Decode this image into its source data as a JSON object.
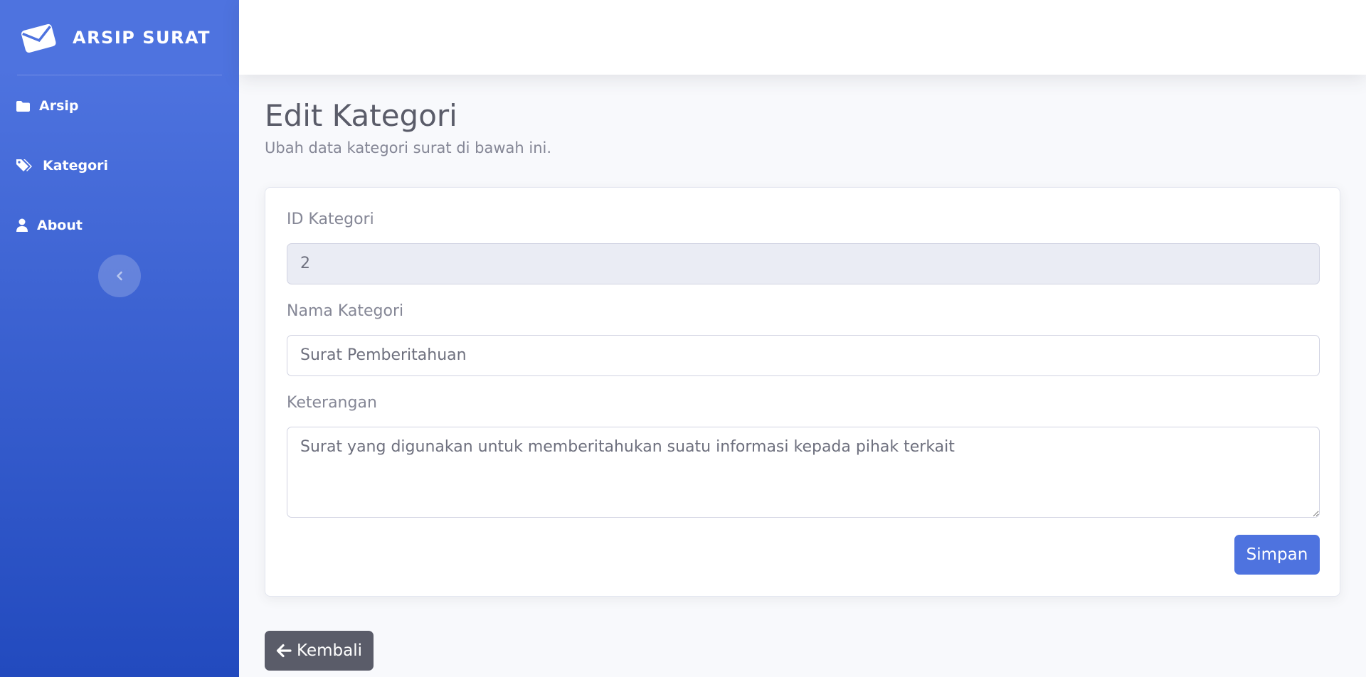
{
  "brand": {
    "name": "ARSIP SURAT",
    "icon": "envelope-icon"
  },
  "sidebar": {
    "items": [
      {
        "label": "Arsip",
        "icon": "folder-icon"
      },
      {
        "label": "Kategori",
        "icon": "tags-icon"
      },
      {
        "label": "About",
        "icon": "user-icon"
      }
    ],
    "toggle_icon": "chevron-left-icon"
  },
  "page": {
    "title": "Edit Kategori",
    "subtitle": "Ubah data kategori surat di bawah ini."
  },
  "form": {
    "id_label": "ID Kategori",
    "id_value": "2",
    "name_label": "Nama Kategori",
    "name_value": "Surat Pemberitahuan",
    "desc_label": "Keterangan",
    "desc_value": "Surat yang digunakan untuk memberitahukan suatu informasi kepada pihak terkait",
    "save_label": "Simpan"
  },
  "back_button": {
    "label": "Kembali",
    "icon": "arrow-left-icon"
  },
  "colors": {
    "primary": "#4e73df",
    "sidebar_bottom": "#224abe",
    "secondary": "#5a5c69",
    "readonly_bg": "#eaecf4"
  }
}
